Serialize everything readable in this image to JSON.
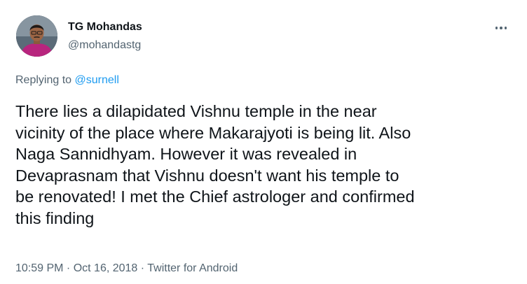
{
  "author": {
    "name": "TG Mohandas",
    "handle": "@mohandastg",
    "avatar_icon": "profile-photo"
  },
  "more_icon": "more-horizontal-icon",
  "reply": {
    "prefix": "Replying to ",
    "target": "@surnell"
  },
  "tweet": {
    "lines": [
      "There lies a dilapidated Vishnu temple in the near",
      "vicinity of the place where Makarajyoti is being lit. Also",
      "Naga Sannidhyam. However it was revealed in",
      "Devaprasnam that Vishnu doesn't want his temple to",
      "be renovated! I met the Chief astrologer and confirmed",
      "this finding"
    ]
  },
  "meta": {
    "time": "10:59 PM",
    "separator": " · ",
    "date": "Oct 16, 2018",
    "source": "Twitter for Android"
  },
  "colors": {
    "link": "#1d9bf0",
    "secondary_text": "#536471",
    "primary_text": "#0f1419"
  }
}
